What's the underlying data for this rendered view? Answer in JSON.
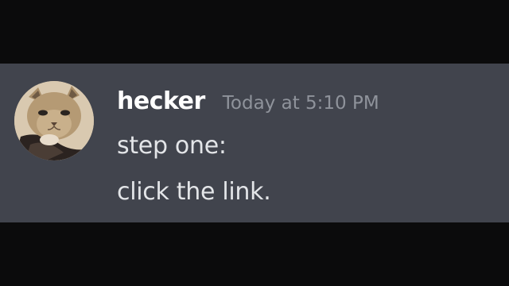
{
  "message": {
    "author": "hecker",
    "timestamp": "Today at 5:10 PM",
    "lines": [
      "step one:",
      "click the link."
    ],
    "avatar_icon": "cat-avatar-icon"
  },
  "colors": {
    "page_background": "#0b0b0c",
    "message_background": "#41444d",
    "username": "#ffffff",
    "timestamp": "#8f939b",
    "message_text": "#e3e5e8"
  }
}
